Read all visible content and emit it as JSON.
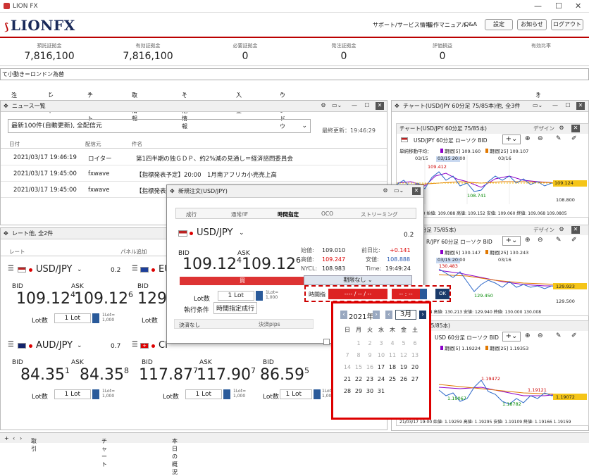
{
  "app": {
    "title": "LION FX",
    "logo": "LIONFX"
  },
  "header": {
    "links": [
      "サポート/サービス情報",
      "操作マニュアル",
      "Q&A"
    ],
    "buttons": [
      "設定",
      "お知らせ",
      "ログアウト"
    ]
  },
  "account": [
    {
      "label": "預託証拠金",
      "value": "7,816,100"
    },
    {
      "label": "有効証拠金",
      "value": "7,816,100"
    },
    {
      "label": "必要証拠金",
      "value": "0"
    },
    {
      "label": "発注証拠金",
      "value": "0"
    },
    {
      "label": "評価損益",
      "value": "0"
    },
    {
      "label": "有効比率",
      "value": ""
    }
  ],
  "ticker": "て小動き＝ロンドン為替",
  "menu": [
    "注文",
    "レート",
    "チャート",
    "取引情報",
    "その他情報",
    "入出金",
    "ウィンドウ"
  ],
  "menu_right": "オプション取引",
  "news": {
    "title": "ニュース一覧",
    "filter": "最新100件(自動更新), 全配信元",
    "last_update": "最終更新：19:46:29",
    "columns": [
      "日付",
      "配信元",
      "件名"
    ],
    "rows": [
      {
        "date": "2021/03/17 19:46:19",
        "source": "ロイター",
        "subject": "第1四半期の独ＧＤＰ、約2%減の見通し＝経済諮問委員会"
      },
      {
        "date": "2021/03/17 19:45:00",
        "source": "fxwave",
        "subject": "【指標発表予定】20:00　1月南アフリカ小売売上高"
      },
      {
        "date": "2021/03/17 19:45:00",
        "source": "fxwave",
        "subject": "【指標発表予"
      }
    ]
  },
  "rates": {
    "title": "レート他, 全2件",
    "col_label": "レート",
    "col_right": "パネル追加",
    "cards": [
      {
        "sym": "USD/JPY",
        "spread": "0.2",
        "bid_label": "BID",
        "ask_label": "ASK",
        "bid_main": "109.12",
        "bid_sup": "4",
        "ask_main": "109.12",
        "ask_sup": "6",
        "lot_label": "Lot数",
        "lot": "1",
        "lot_unit": "Lot",
        "lot_note1": "1Lot=",
        "lot_note2": "1,000"
      },
      {
        "sym": "EU",
        "spread": "",
        "bid_label": "BID",
        "ask_label": "",
        "bid_main": "129.9",
        "bid_sup": "",
        "ask_main": "",
        "ask_sup": "",
        "lot_label": "Lot数",
        "lot": "",
        "lot_unit": "",
        "lot_note1": "",
        "lot_note2": ""
      },
      {
        "sym": "AUD/JPY",
        "spread": "0.7",
        "bid_label": "BID",
        "ask_label": "ASK",
        "bid_main": "84.35",
        "bid_sup": "1",
        "ask_main": "84.35",
        "ask_sup": "8",
        "lot_label": "Lot数",
        "lot": "1",
        "lot_unit": "Lot",
        "lot_note1": "1Lot=",
        "lot_note2": "1,000"
      },
      {
        "sym": "CI",
        "spread": "",
        "bid_label": "BID",
        "ask_label": "ASK",
        "bid_main": "117.87",
        "bid_sup": "7",
        "ask_main": "117.90",
        "ask_sup": "7",
        "lot_label": "Lot数",
        "lot": "1",
        "lot_unit": "Lot",
        "lot_note1": "1Lot=",
        "lot_note2": "1,000"
      },
      {
        "sym": "",
        "spread": "",
        "bid_label": "BID",
        "ask_label": "",
        "bid_main": "86.59",
        "bid_sup": "5",
        "ask_main": "",
        "ask_sup": "",
        "lot_label": "Lot数",
        "lot": "1",
        "lot_unit": "Lot",
        "lot_note1": "1Lot=",
        "lot_note2": "1,000"
      }
    ]
  },
  "charts": {
    "title": "チャート(USD/JPY 60分足 75/85本)他, 全3件",
    "design": "デザイン",
    "panels": [
      {
        "title": "チャート(USD/JPY 60分足 75/85本)",
        "sym": "USD/JPY 60分足 ローソク BID",
        "legend1": "期間[5] 109.160",
        "legend2": "期間[25] 109.107",
        "tick_label": "単純移動平均：",
        "dates": [
          "03/15",
          "03/15 20:00",
          "03/16"
        ],
        "hi": "109.412",
        "lo": "108.741",
        "price": "109.124",
        "axis": "108.800",
        "ohlc": "03/17 19:00 始値: 109.088 高値: 109.152 安値: 109.060 終値: 109.068 109.0805"
      },
      {
        "title": "R/JPY 60分足 75/85本)",
        "sym": "R/JPY 60分足 ローソク BID",
        "legend1": "期間[5] 130.147",
        "legend2": "期間[25] 130.243",
        "dates": [
          "03/15 20:00",
          "03/16"
        ],
        "hi": "130.483",
        "lo": "129.450",
        "price": "129.923",
        "axis": "129.500",
        "ohlc": "0 始値: 129.938 高値: 130.213 安値: 129.940 終値: 130.000 130.008"
      },
      {
        "title": "SD 60分足 75/85本)",
        "sym": "USD 60分足 ローソク BID",
        "legend1": "期間[5] 1.19224",
        "legend2": "期間[25] 1.19353",
        "dates": [],
        "hi": "1.19472",
        "lo": "1.18782",
        "price": "1.19072",
        "mark1": "1.19067",
        "mark2": "1.19121",
        "ohlc": "21/03/17 19:00 始値: 1.19259 高値: 1.19295 安値: 1.19109 終値: 1.19166 1.19159"
      }
    ]
  },
  "order": {
    "title": "新規注文(USD/JPY)",
    "tabs": [
      "成行",
      "通常/IF",
      "時間指定",
      "OCO",
      "ストリーミング"
    ],
    "sym": "USD/JPY",
    "spread": "0.2",
    "bid_label": "BID",
    "ask_label": "ASK",
    "bid_main": "109.12",
    "bid_sup": "4",
    "ask_main": "109.12",
    "ask_sup": "6",
    "stats": [
      {
        "k": "始値:",
        "v": "109.010",
        "k2": "前日比:",
        "v2": "+0.141"
      },
      {
        "k": "高値:",
        "v": "109.247",
        "k2": "安値:",
        "v2": "108.888"
      },
      {
        "k": "NYCL:",
        "v": "108.983",
        "k2": "Time:",
        "v2": "19:49:24"
      }
    ],
    "buy": "買",
    "sell_side": "売",
    "lot_label": "Lot数",
    "lot": "1",
    "lot_unit": "Lot",
    "lot_note1": "1Lot=",
    "lot_note2": "1,000",
    "cond_label": "執行条件",
    "cond": "時間指定成行",
    "settle_none": "決済なし",
    "settle_pips": "決済pips",
    "cancel_label": "期限なし",
    "time_label": "時間指",
    "date_field": "---- / -- / --",
    "time_field": "-- : --",
    "ok": "OK"
  },
  "calendar": {
    "year": "2021年",
    "month": "3月",
    "weekdays": [
      "日",
      "月",
      "火",
      "水",
      "木",
      "金",
      "土"
    ],
    "rows": [
      [
        "",
        "1",
        "2",
        "3",
        "4",
        "5",
        "6"
      ],
      [
        "7",
        "8",
        "9",
        "10",
        "11",
        "12",
        "13"
      ],
      [
        "14",
        "15",
        "16",
        "17",
        "18",
        "19",
        "20"
      ],
      [
        "21",
        "22",
        "23",
        "24",
        "25",
        "26",
        "27"
      ],
      [
        "28",
        "29",
        "30",
        "31",
        "",
        "",
        ""
      ]
    ],
    "enabled_from": 17
  },
  "bottom_tabs": [
    "取引",
    "チャート",
    "本日の概況"
  ]
}
